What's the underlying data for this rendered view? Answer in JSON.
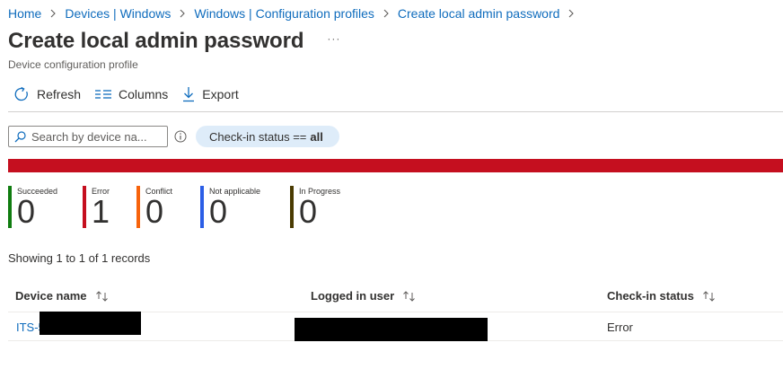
{
  "breadcrumb": [
    "Home",
    "Devices | Windows",
    "Windows | Configuration profiles",
    "Create local admin password"
  ],
  "header": {
    "title": "Create local admin password",
    "more_label": "···",
    "subtitle": "Device configuration profile"
  },
  "toolbar": {
    "refresh_label": "Refresh",
    "columns_label": "Columns",
    "export_label": "Export"
  },
  "search": {
    "placeholder": "Search by device na..."
  },
  "filter": {
    "label": "Check-in status ==",
    "value": "all"
  },
  "status_bar_color": "#c50f1f",
  "tiles": [
    {
      "label": "Succeeded",
      "count": "0",
      "color": "#107c10"
    },
    {
      "label": "Error",
      "count": "1",
      "color": "#c50f1f"
    },
    {
      "label": "Conflict",
      "count": "0",
      "color": "#f7630c"
    },
    {
      "label": "Not applicable",
      "count": "0",
      "color": "#2b5ee6"
    },
    {
      "label": "In Progress",
      "count": "0",
      "color": "#4a3b02"
    }
  ],
  "records_text": "Showing 1 to 1 of 1 records",
  "table": {
    "columns": [
      "Device name",
      "Logged in user",
      "Check-in status"
    ],
    "rows": [
      {
        "device": "ITS-5",
        "user": "",
        "status": "Error"
      }
    ]
  }
}
